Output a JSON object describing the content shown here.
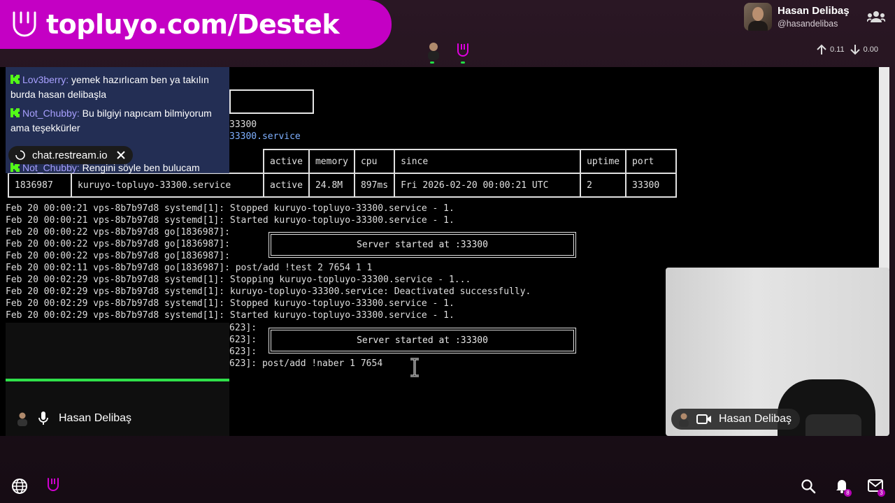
{
  "banner": {
    "url_text": "topluyo.com/Destek"
  },
  "profile": {
    "name": "Hasan Delibaş",
    "handle": "@hasandelibas"
  },
  "stats": {
    "up": "0.11",
    "down": "0.00"
  },
  "chat": {
    "messages": [
      {
        "user": "Lov3berry:",
        "text": "yemek hazırlıcam ben ya takılın burda hasan delibaşla"
      },
      {
        "user": "Not_Chubby:",
        "text": "Bu bilgiyi napıcam bilmiyorum ama teşekkürler"
      },
      {
        "user": "Not_Chubby:",
        "text": "Rengini söyle ben bulucam"
      }
    ],
    "overlay_label": "chat.restream.io"
  },
  "terminal": {
    "top_lines": [
      "33300",
      "33300.service"
    ],
    "table": {
      "headers": [
        "active",
        "memory",
        "cpu",
        "since",
        "uptime",
        "port"
      ],
      "row": [
        "1836987",
        "kuruyo-topluyo-33300.service",
        "active",
        "24.8M",
        "897ms",
        "Fri 2026-02-20 00:00:21 UTC",
        "2",
        "33300"
      ]
    },
    "log_lines": [
      "Feb 20 00:00:21 vps-8b7b97d8 systemd[1]: Stopped kuruyo-topluyo-33300.service - 1.",
      "Feb 20 00:00:21 vps-8b7b97d8 systemd[1]: Started kuruyo-topluyo-33300.service - 1.",
      "Feb 20 00:00:22 vps-8b7b97d8 go[1836987]:",
      "Feb 20 00:00:22 vps-8b7b97d8 go[1836987]:",
      "Feb 20 00:00:22 vps-8b7b97d8 go[1836987]:",
      "Feb 20 00:02:11 vps-8b7b97d8 go[1836987]: post/add !test 2 7654 1 1",
      "Feb 20 00:02:29 vps-8b7b97d8 systemd[1]: Stopping kuruyo-topluyo-33300.service - 1...",
      "Feb 20 00:02:29 vps-8b7b97d8 systemd[1]: kuruyo-topluyo-33300.service: Deactivated successfully.",
      "Feb 20 00:02:29 vps-8b7b97d8 systemd[1]: Stopped kuruyo-topluyo-33300.service - 1.",
      "Feb 20 00:02:29 vps-8b7b97d8 systemd[1]: Started kuruyo-topluyo-33300.service - 1."
    ],
    "tail_lines": [
      "623]:",
      "623]:",
      "623]:",
      "623]: post/add !naber 1 7654"
    ],
    "server_started": "Server started at :33300"
  },
  "mic_tag": {
    "name": "Hasan Delibaş"
  },
  "cam_tag": {
    "name": "Hasan Delibaş"
  },
  "bottom": {
    "bell_badge": "8",
    "mail_badge": "3"
  },
  "colors": {
    "brand": "#c400c4",
    "accent_green": "#2fe04a",
    "chat_bg": "#283460"
  }
}
